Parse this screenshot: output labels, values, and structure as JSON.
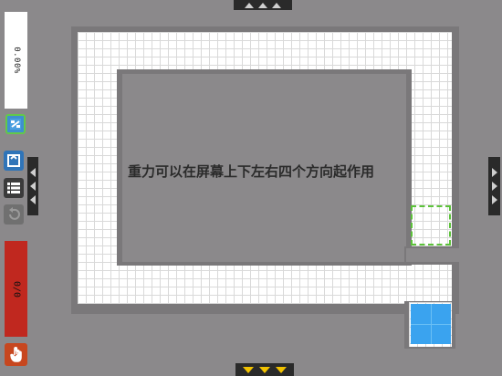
{
  "sidebar": {
    "progress_text": "0.00%",
    "moves_text": "0/0",
    "buttons": {
      "hint": "hint-icon",
      "flip": "flip-icon",
      "menu": "menu-icon",
      "undo": "undo-icon",
      "hand": "hand-icon"
    }
  },
  "board": {
    "caption": "重力可以在屏幕上下左右四个方向起作用"
  },
  "colors": {
    "background": "#8b898b",
    "floor": "#ffffff",
    "player": "#3aa3ef",
    "goal_border": "#5cc23a",
    "moves_panel": "#c0281f",
    "active_arrow": "#f2c200"
  }
}
